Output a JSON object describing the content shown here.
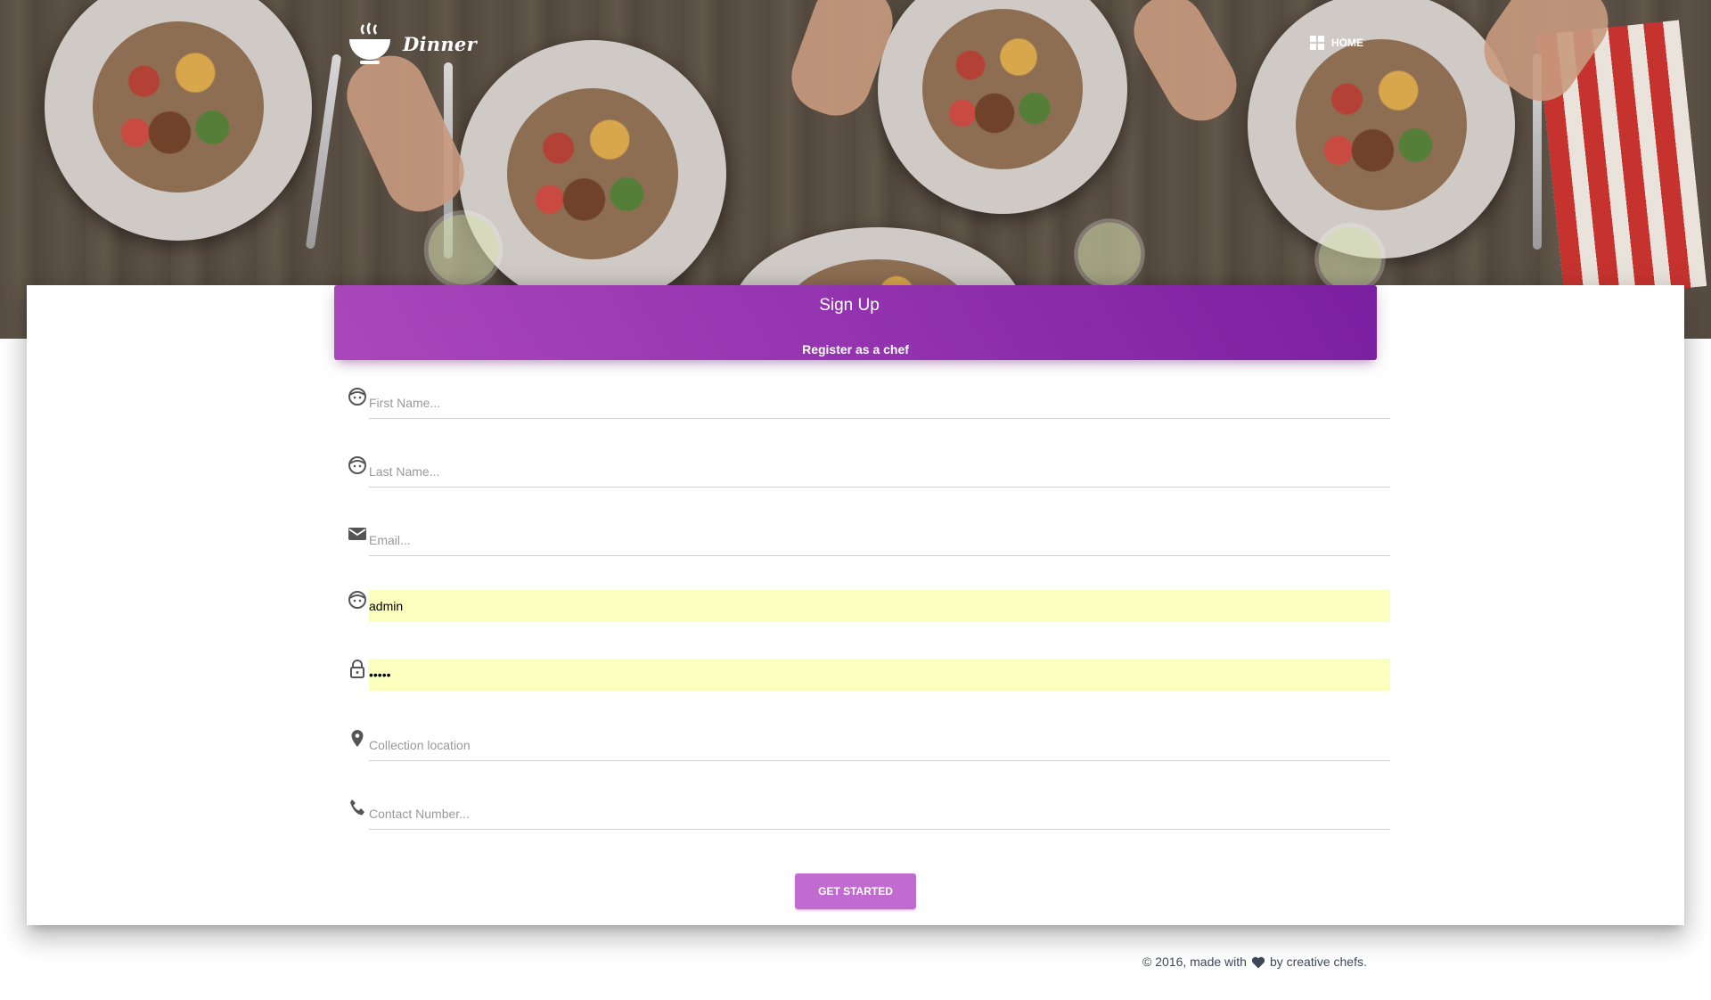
{
  "navbar": {
    "brand_name": "Dinner",
    "brand_icon": "soup-bowl-icon",
    "home_label": "HOME",
    "home_icon": "dashboard-icon"
  },
  "card": {
    "title": "Sign Up",
    "subtitle": "Register as a chef"
  },
  "form": {
    "first_name": {
      "icon": "face-icon",
      "placeholder": "First Name...",
      "value": ""
    },
    "last_name": {
      "icon": "face-icon",
      "placeholder": "Last Name...",
      "value": ""
    },
    "email": {
      "icon": "email-icon",
      "placeholder": "Email...",
      "value": ""
    },
    "username": {
      "icon": "face-icon",
      "placeholder": "",
      "value": "admin"
    },
    "password": {
      "icon": "lock-icon",
      "placeholder": "",
      "value": "•••••"
    },
    "location": {
      "icon": "location-pin-icon",
      "placeholder": "Collection location",
      "value": ""
    },
    "contact": {
      "icon": "phone-icon",
      "placeholder": "Contact Number...",
      "value": ""
    },
    "submit_label": "GET STARTED"
  },
  "colors": {
    "header_gradient_start": "#ab47bc",
    "header_gradient_end": "#7b1fa2",
    "button": "#c16bd0",
    "autofill": "#faffbd"
  },
  "footer": {
    "prefix": "© 2016, made with",
    "heart_icon": "heart-icon",
    "suffix": "by creative chefs."
  }
}
